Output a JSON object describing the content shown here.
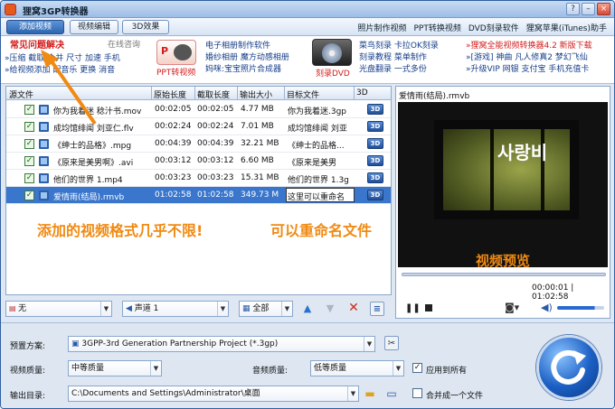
{
  "app": {
    "title": "狸窝3GP转换器"
  },
  "menu": {
    "tabs": [
      {
        "label": "添加视频"
      },
      {
        "label": "视频编辑"
      },
      {
        "label": "3D效果"
      }
    ],
    "links": [
      "照片制作视频",
      "PPT转换视频",
      "DVD刻录软件",
      "狸窝苹果(iTunes)助手"
    ]
  },
  "ads": {
    "faq_title": "常见问题解决",
    "online": "在线咨询",
    "faq_line1": "»压缩 截取 合并 尺寸 加速 手机",
    "faq_line2": "»给视频添加 配音乐 更换 消音",
    "ppt_label": "PPT转视频",
    "mid_line1": "电子相册制作软件",
    "mid_line2": "婚纱相册 魔方动感相册",
    "mid_line3": "妈咪:宝宝照片合成器",
    "dvd_label": "刻录DVD",
    "r1_line1": "菜鸟刻录 卡拉OK刻录",
    "r1_line2": "刻录教程 菜单制作",
    "r1_line3": "光盘翻录 一式多份",
    "r2_line1": "»狸窝全能视频转换器4.2 新版下载",
    "r2_line2": "»[游戏] 神曲 凡人修真2 梦幻飞仙",
    "r2_line3": "»升级VIP 网银 支付宝 手机充值卡"
  },
  "table": {
    "headers": [
      "源文件",
      "原始长度",
      "截取长度",
      "输出大小",
      "目标文件",
      "3D"
    ],
    "rows": [
      {
        "src": "你为我着迷 稔汁书.mov",
        "orig": "00:02:05",
        "cut": "00:02:05",
        "size": "4.77 MB",
        "target": "你为我着迷.3gp"
      },
      {
        "src": "成均馆绯闻 刘亚仁.flv",
        "orig": "00:02:24",
        "cut": "00:02:24",
        "size": "7.01 MB",
        "target": "成均馆绯闻 刘亚"
      },
      {
        "src": "《绅士的品格》.mpg",
        "orig": "00:04:39",
        "cut": "00:04:39",
        "size": "32.21 MB",
        "target": "《绅士的品格..."
      },
      {
        "src": "《原来是美男啊》.avi",
        "orig": "00:03:12",
        "cut": "00:03:12",
        "size": "6.60 MB",
        "target": "《原来是美男"
      },
      {
        "src": "他们的世界 1.mp4",
        "orig": "00:03:23",
        "cut": "00:03:23",
        "size": "15.31 MB",
        "target": "他们的世界 1.3g"
      },
      {
        "src": "爱情雨(结局).rmvb",
        "orig": "01:02:58",
        "cut": "01:02:58",
        "size": "349.73 M",
        "target": "这里可以重命名"
      }
    ],
    "badge": "3D"
  },
  "overlays": {
    "left": "添加的视频格式几乎不限!",
    "right": "可以重命名文件",
    "preview": "视频预览"
  },
  "controls": {
    "subtitle": "无",
    "audio": "声道 1",
    "range": "全部"
  },
  "preview": {
    "title": "爱情雨(结局).rmvb",
    "current": "00:00:01",
    "total": "01:02:58",
    "video_caption": "사랑비"
  },
  "settings": {
    "preset_label": "预置方案:",
    "preset_value": "3GPP-3rd Generation Partnership Project (*.3gp)",
    "vq_label": "视频质量:",
    "vq_value": "中等质量",
    "aq_label": "音频质量:",
    "aq_value": "低等质量",
    "apply_all": "应用到所有",
    "out_label": "输出目录:",
    "out_value": "C:\\Documents and Settings\\Administrator\\桌面",
    "merge": "合并成一个文件"
  }
}
